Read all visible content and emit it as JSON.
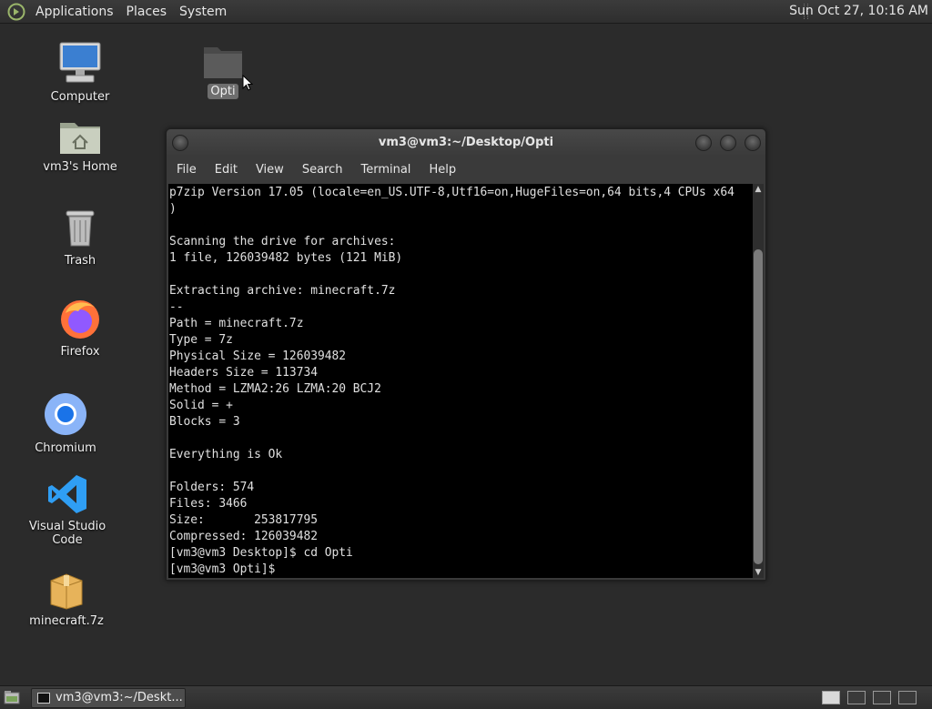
{
  "top_panel": {
    "menus": [
      "Applications",
      "Places",
      "System"
    ],
    "clock": "Sun Oct 27, 10:16 AM"
  },
  "desktop": {
    "icons": [
      {
        "label": "Computer",
        "icon": "computer-icon"
      },
      {
        "label": "vm3's Home",
        "icon": "home-folder-icon"
      },
      {
        "label": "Trash",
        "icon": "trash-icon"
      },
      {
        "label": "Firefox",
        "icon": "firefox-icon"
      },
      {
        "label": "Chromium",
        "icon": "chromium-icon"
      },
      {
        "label": "Visual Studio Code",
        "icon": "vscode-icon"
      },
      {
        "label": "minecraft.7z",
        "icon": "archive-icon"
      },
      {
        "label": "Opti",
        "icon": "folder-icon",
        "selected": true
      }
    ]
  },
  "terminal": {
    "title": "vm3@vm3:~/Desktop/Opti",
    "menu": [
      "File",
      "Edit",
      "View",
      "Search",
      "Terminal",
      "Help"
    ],
    "lines": [
      "p7zip Version 17.05 (locale=en_US.UTF-8,Utf16=on,HugeFiles=on,64 bits,4 CPUs x64",
      ")",
      "",
      "Scanning the drive for archives:",
      "1 file, 126039482 bytes (121 MiB)",
      "",
      "Extracting archive: minecraft.7z",
      "--",
      "Path = minecraft.7z",
      "Type = 7z",
      "Physical Size = 126039482",
      "Headers Size = 113734",
      "Method = LZMA2:26 LZMA:20 BCJ2",
      "Solid = +",
      "Blocks = 3",
      "",
      "Everything is Ok",
      "",
      "Folders: 574",
      "Files: 3466",
      "Size:       253817795",
      "Compressed: 126039482",
      "[vm3@vm3 Desktop]$ cd Opti",
      "[vm3@vm3 Opti]$"
    ]
  },
  "taskbar": {
    "window_button": "vm3@vm3:~/Deskt..."
  }
}
